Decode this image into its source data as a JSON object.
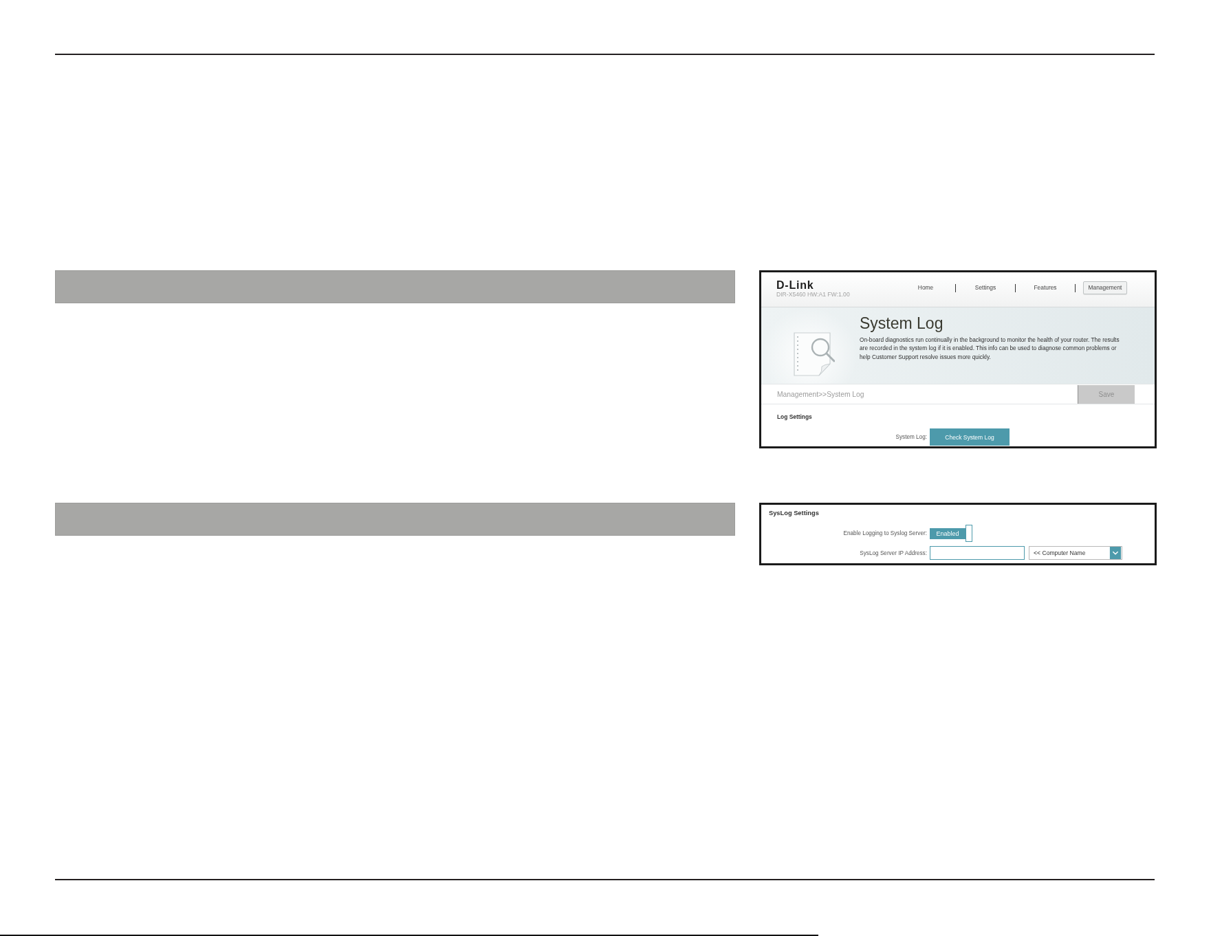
{
  "system_log_screenshot": {
    "header": {
      "logo": "D-Link",
      "model": "DIR-X5460 HW:A1 FW:1.00",
      "nav": [
        {
          "label": "Home",
          "selected": false
        },
        {
          "label": "Settings",
          "selected": false
        },
        {
          "label": "Features",
          "selected": false
        },
        {
          "label": "Management",
          "selected": true
        }
      ]
    },
    "hero": {
      "title": "System Log",
      "description": "On-board diagnostics run continually in the background to monitor the health of your router. The results are recorded in the system log if it is enabled. This info can be used to diagnose common problems or help Customer Support resolve issues more quickly."
    },
    "breadcrumb": "Management>>System Log",
    "save_button": {
      "label": "Save",
      "disabled": true
    },
    "section_title": "Log Settings",
    "fields": [
      {
        "kind": "button",
        "label": "System Log:",
        "button_label": "Check System Log"
      }
    ]
  },
  "syslog_screenshot": {
    "section_title": "SysLog Settings",
    "fields": [
      {
        "kind": "toggle",
        "label": "Enable Logging to Syslog Server:",
        "on": true,
        "value": "Enabled"
      },
      {
        "kind": "address",
        "label": "SysLog Server IP Address:",
        "select": "<< Computer Name"
      }
    ]
  }
}
